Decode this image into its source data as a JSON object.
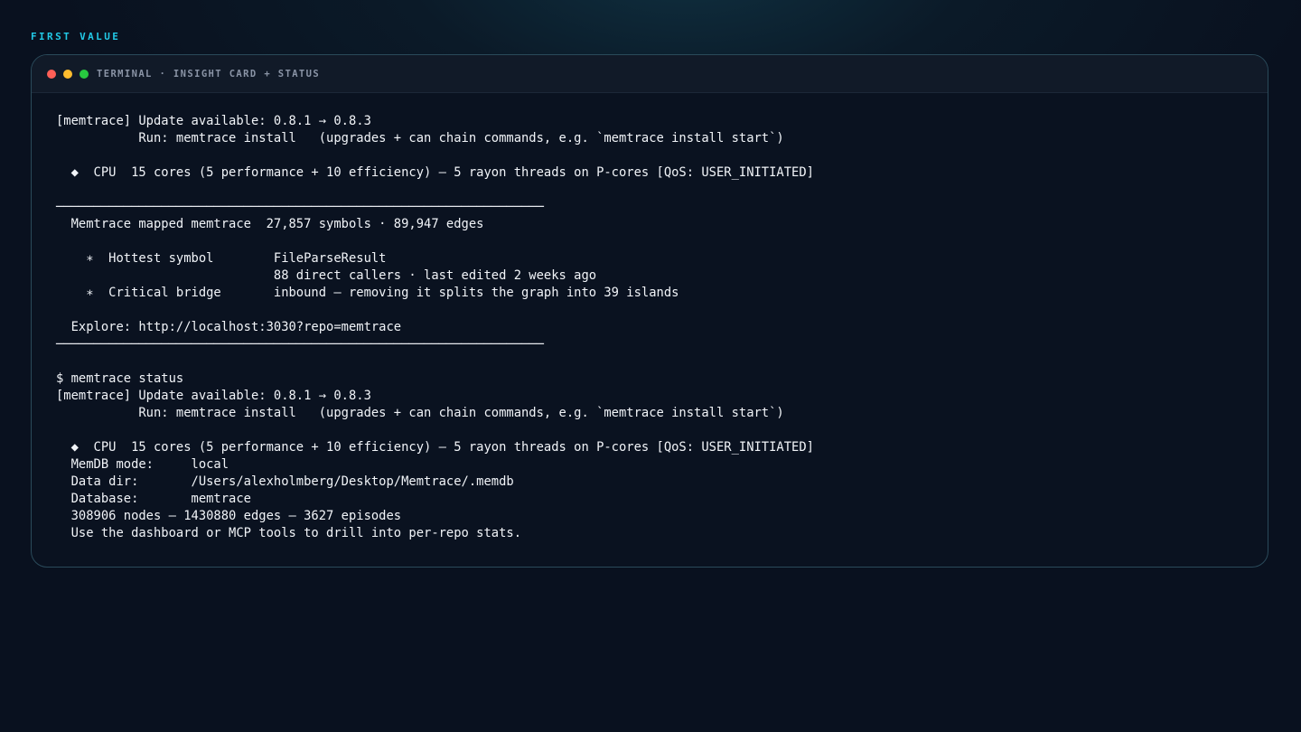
{
  "section_label": "FIRST VALUE",
  "window": {
    "title": "TERMINAL · INSIGHT CARD + STATUS"
  },
  "colors": {
    "accent": "#22c9e6",
    "background": "#09111f",
    "terminal_bg": "#0a1220",
    "text": "#f1f4f8",
    "dot_close": "#ff5f57",
    "dot_minimize": "#febc2e",
    "dot_maximize": "#28c840"
  },
  "terminal_lines": [
    "[memtrace] Update available: 0.8.1 → 0.8.3",
    "           Run: memtrace install   (upgrades + can chain commands, e.g. `memtrace install start`)",
    "",
    "  ◆  CPU  15 cores (5 performance + 10 efficiency) — 5 rayon threads on P-cores [QoS: USER_INITIATED]",
    "",
    "─────────────────────────────────────────────────────────────────",
    "  Memtrace mapped memtrace  27,857 symbols · 89,947 edges",
    "",
    "    ∗  Hottest symbol        FileParseResult",
    "                             88 direct callers · last edited 2 weeks ago",
    "    ∗  Critical bridge       inbound — removing it splits the graph into 39 islands",
    "",
    "  Explore: http://localhost:3030?repo=memtrace",
    "─────────────────────────────────────────────────────────────────",
    "",
    "$ memtrace status",
    "[memtrace] Update available: 0.8.1 → 0.8.3",
    "           Run: memtrace install   (upgrades + can chain commands, e.g. `memtrace install start`)",
    "",
    "  ◆  CPU  15 cores (5 performance + 10 efficiency) — 5 rayon threads on P-cores [QoS: USER_INITIATED]",
    "  MemDB mode:     local",
    "  Data dir:       /Users/alexholmberg/Desktop/Memtrace/.memdb",
    "  Database:       memtrace",
    "  308906 nodes — 1430880 edges — 3627 episodes",
    "  Use the dashboard or MCP tools to drill into per-repo stats."
  ]
}
